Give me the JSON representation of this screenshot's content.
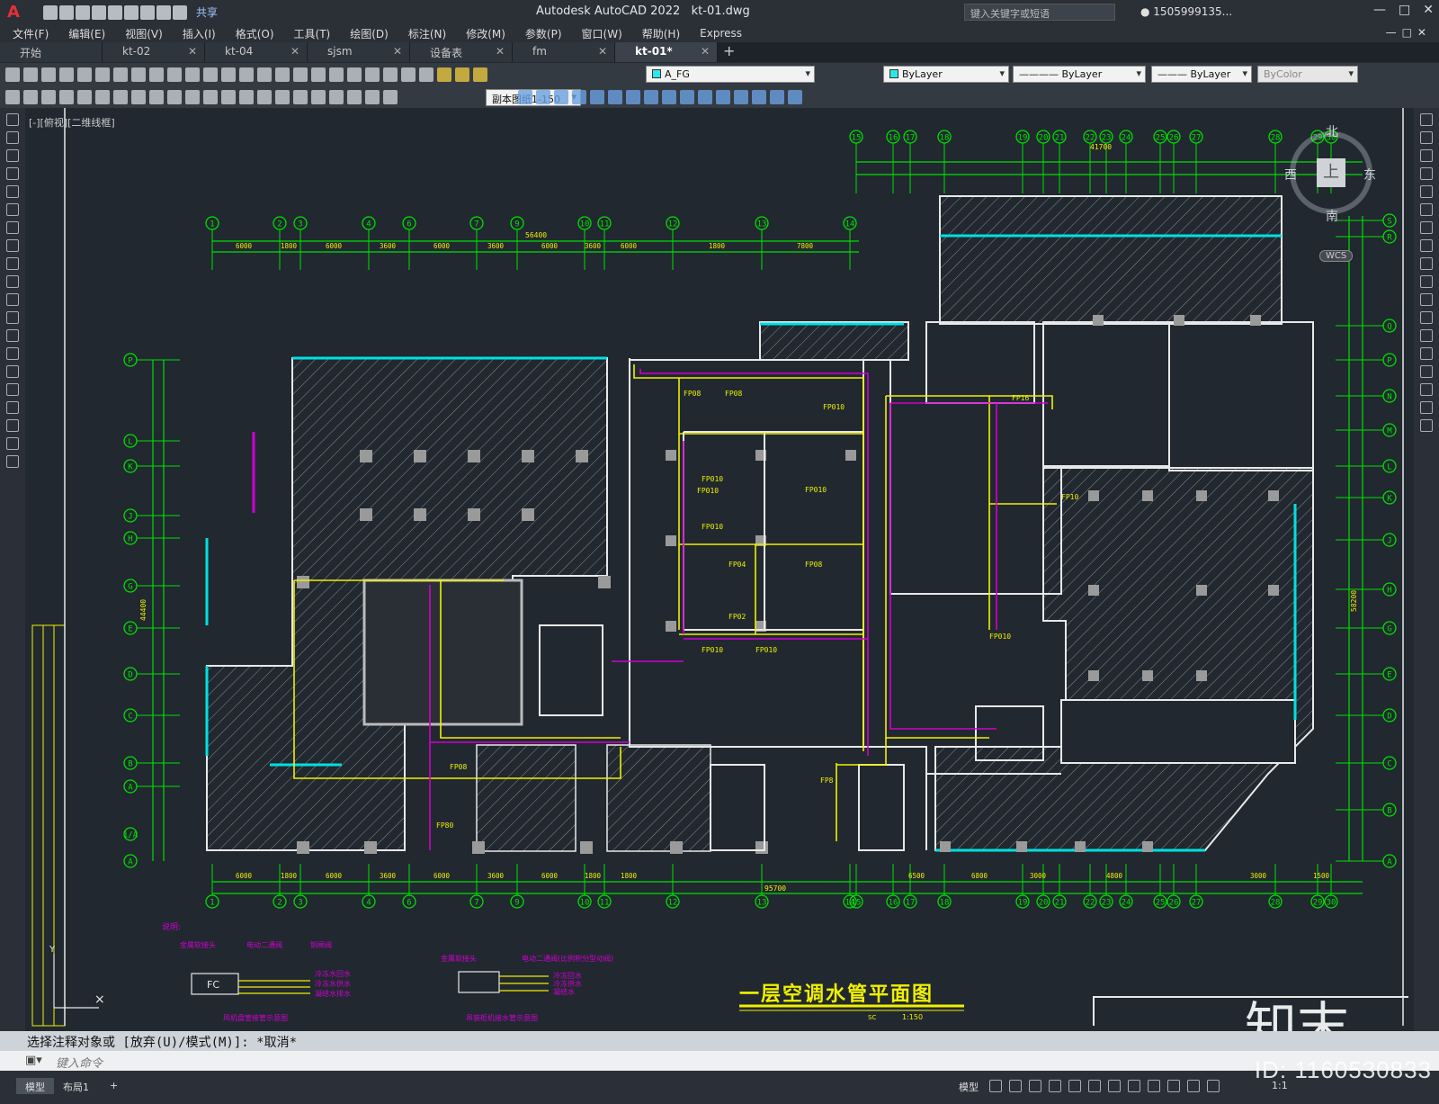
{
  "app": {
    "title": "Autodesk AutoCAD 2022",
    "file": "kt-01.dwg",
    "share_label": "共享",
    "search_placeholder": "键入关键字或短语",
    "user": "1505999135..."
  },
  "menu": [
    "文件(F)",
    "编辑(E)",
    "视图(V)",
    "插入(I)",
    "格式(O)",
    "工具(T)",
    "绘图(D)",
    "标注(N)",
    "修改(M)",
    "参数(P)",
    "窗口(W)",
    "帮助(H)",
    "Express"
  ],
  "tabs": [
    {
      "label": "开始",
      "active": false
    },
    {
      "label": "kt-02",
      "active": false
    },
    {
      "label": "kt-04",
      "active": false
    },
    {
      "label": "sjsm",
      "active": false
    },
    {
      "label": "设备表",
      "active": false
    },
    {
      "label": "fm",
      "active": false
    },
    {
      "label": "kt-01*",
      "active": true
    }
  ],
  "toolbar": {
    "layer": "A_FG",
    "color": "ByLayer",
    "linetype": "ByLayer",
    "lineweight": "ByLayer",
    "plotstyle": "ByColor",
    "scale": "副本图纸1-150"
  },
  "viewport": {
    "label": "[-][俯视][二维线框]",
    "cube_top": "上",
    "north": "北",
    "south": "南",
    "east": "东",
    "west": "西",
    "wcs": "WCS"
  },
  "drawing": {
    "title": "一层空调水管平面图",
    "scale": "1:150",
    "scale_prefix": "SC",
    "top_total": "56400",
    "bottom_total": "95700",
    "right_top_total": "41700",
    "left_total": "44400",
    "right_total": "58200",
    "left_axes": [
      "P",
      "L",
      "K",
      "J",
      "H",
      "G",
      "E",
      "D",
      "C",
      "B",
      "A"
    ],
    "right_axes": [
      "S",
      "R",
      "Q",
      "P",
      "N",
      "M",
      "L",
      "K",
      "J",
      "H",
      "G",
      "E",
      "D",
      "C",
      "B",
      "A"
    ],
    "top_axes_left": [
      "1",
      "2",
      "3",
      "4",
      "6",
      "7",
      "9",
      "10",
      "11",
      "12",
      "13",
      "14"
    ],
    "top_axes_right": [
      "15",
      "16",
      "17",
      "18",
      "19",
      "20",
      "21",
      "22",
      "23",
      "24",
      "25",
      "26",
      "27",
      "28",
      "29",
      "30"
    ],
    "bottom_axes": [
      "1",
      "2",
      "3",
      "4",
      "6",
      "7",
      "9",
      "10",
      "11",
      "12",
      "13",
      "14",
      "15",
      "16",
      "17",
      "18",
      "19",
      "20",
      "21",
      "22",
      "23",
      "24",
      "25",
      "26",
      "27",
      "28",
      "29",
      "30"
    ],
    "top_dims_left": [
      "6000",
      "1800",
      "6000",
      "3600",
      "6000",
      "3600",
      "6000",
      "3600",
      "6000",
      "1800",
      "7800"
    ],
    "bottom_dims": [
      "6000",
      "1800",
      "6000",
      "3600",
      "6000",
      "3600",
      "6000",
      "1800",
      "1800",
      "6500",
      "6800",
      "3000",
      "4800",
      "3000",
      "1500"
    ],
    "legend_title": "说明:",
    "legend1_labels": [
      "金属软接头",
      "电动二通阀",
      "铜闸阀"
    ],
    "legend1_flows": [
      "冷冻水回水",
      "冷冻水供水",
      "凝结水排水"
    ],
    "legend1_caption": "风机盘管接管示意图",
    "legend1_box": "FC",
    "legend2_labels": [
      "金属软接头",
      "电动二通阀(比例积分型动阀)"
    ],
    "legend2_flows": [
      "冷冻回水",
      "冷冻供水",
      "凝结水"
    ],
    "legend2_caption": "吊装柜机接水管示意图"
  },
  "command": {
    "history": "选择注释对象或 [放弃(U)/模式(M)]: *取消*",
    "placeholder": "键入命令"
  },
  "status": {
    "model_tab": "模型",
    "layout_tab": "布局1",
    "model_indicator": "模型",
    "scale": "1:1"
  },
  "watermark": {
    "brand": "知末",
    "id": "ID: 1160530833"
  },
  "colors": {
    "background": "#212830",
    "axis_green": "#00e000",
    "wall_white": "#e8e8e8",
    "pipe_yellow": "#f0f000",
    "pipe_magenta": "#d000d0",
    "cyan": "#00e0e0"
  }
}
